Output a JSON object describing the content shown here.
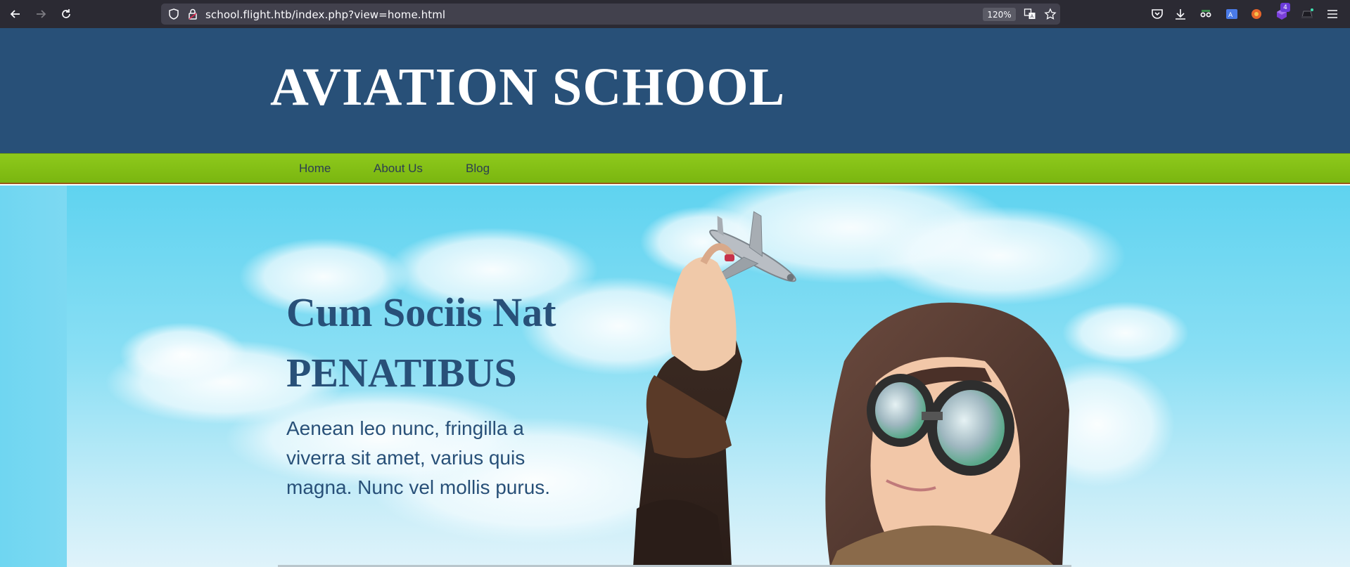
{
  "browser": {
    "url": "school.flight.htb/index.php?view=home.html",
    "zoom": "120%",
    "extension_badge": "4",
    "icons": [
      "back-arrow-icon",
      "forward-arrow-icon",
      "reload-icon",
      "shield-icon",
      "lock-icon",
      "translate-icon",
      "star-icon",
      "pocket-icon",
      "download-icon",
      "spy-extension-icon",
      "translate-extension-icon",
      "fox-extension-icon",
      "cube-extension-icon",
      "hat-extension-icon",
      "menu-icon"
    ]
  },
  "site": {
    "title": "AVIATION SCHOOL",
    "nav": [
      "Home",
      "About Us",
      "Blog"
    ],
    "colors": {
      "header": "#285078",
      "nav": "#84c014",
      "text": "#285078"
    }
  },
  "hero": {
    "heading_line1": "Cum Sociis Nat",
    "heading_line2": "PENATIBUS",
    "body": "Aenean leo nunc, fringilla a viverra sit amet, varius quis magna. Nunc vel mollis purus."
  }
}
